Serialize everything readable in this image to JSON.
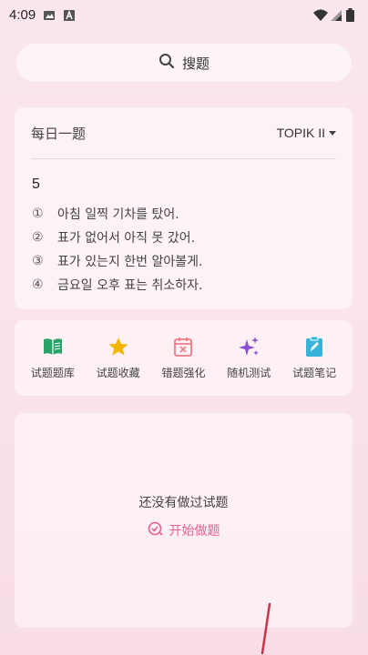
{
  "status_bar": {
    "time": "4:09"
  },
  "search": {
    "label": "搜题"
  },
  "daily": {
    "title": "每日一题",
    "level": "TOPIK II",
    "question_number": "5",
    "options": [
      {
        "mark": "①",
        "text": "아침 일찍 기차를 탔어."
      },
      {
        "mark": "②",
        "text": "표가 없어서 아직 못 갔어."
      },
      {
        "mark": "③",
        "text": "표가 있는지 한번 알아볼게."
      },
      {
        "mark": "④",
        "text": "금요일 오후 표는 취소하자."
      }
    ]
  },
  "tools": [
    {
      "label": "试题题库",
      "icon": "book-icon",
      "color": "#2aa36b"
    },
    {
      "label": "试题收藏",
      "icon": "star-icon",
      "color": "#f5b400"
    },
    {
      "label": "错题强化",
      "icon": "calendar-x-icon",
      "color": "#f07a86"
    },
    {
      "label": "随机测试",
      "icon": "sparkles-icon",
      "color": "#8a4fd6"
    },
    {
      "label": "试题笔记",
      "icon": "note-icon",
      "color": "#36b3d9"
    }
  ],
  "history": {
    "empty_text": "还没有做过试题",
    "start_label": "开始做题"
  },
  "colors": {
    "accent": "#e9608c",
    "background": "#fbe6ec"
  }
}
